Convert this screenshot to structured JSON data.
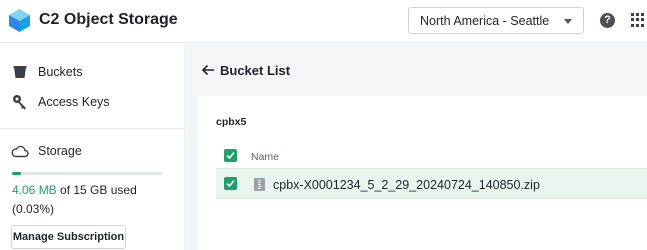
{
  "app": {
    "title": "C2 Object Storage",
    "logo_icon": "cube-logo-icon",
    "accent_color": "#1e9e6a"
  },
  "header": {
    "region_selected": "North America - Seattle",
    "help_icon": "question-circle-icon",
    "apps_icon": "grid-apps-icon"
  },
  "sidebar": {
    "items": [
      {
        "label": "Buckets",
        "icon": "bucket-icon"
      },
      {
        "label": "Access Keys",
        "icon": "key-icon"
      }
    ],
    "storage": {
      "label": "Storage",
      "icon": "cloud-icon",
      "used": "4.06 MB",
      "used_suffix": " of 15 GB used",
      "percent_text": "(0.03%)",
      "percent_value": 0.0003,
      "manage_label": "Manage Subscription"
    }
  },
  "main": {
    "back_icon": "arrow-left-icon",
    "title": "Bucket List",
    "bucket": "cpbx5",
    "table": {
      "columns": [
        "Name"
      ],
      "rows": [
        {
          "name": "cpbx-X0001234_5_2_29_20240724_140850.zip",
          "icon": "zip-file-icon",
          "selected": true
        }
      ]
    }
  }
}
